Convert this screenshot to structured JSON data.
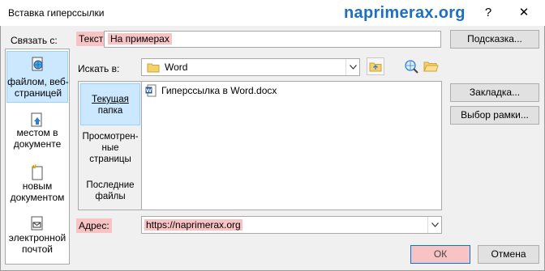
{
  "window": {
    "title": "Вставка гиперссылки",
    "watermark": "naprimerax.org",
    "help_label": "?",
    "close_label": "✕"
  },
  "link_to": {
    "label": "Связать с:",
    "items": [
      {
        "id": "file",
        "label_line1": "файлом, веб-",
        "label_line2": "страницей",
        "icon": "globe-document-icon",
        "selected": true
      },
      {
        "id": "place",
        "label_line1": "местом в",
        "label_line2": "документе",
        "icon": "document-bookmark-icon",
        "selected": false
      },
      {
        "id": "new",
        "label_line1": "новым",
        "label_line2": "документом",
        "icon": "new-document-icon",
        "selected": false
      },
      {
        "id": "email",
        "label_line1": "электронной",
        "label_line2": "почтой",
        "icon": "email-icon",
        "selected": false
      }
    ]
  },
  "text_field": {
    "label": "Текст:",
    "value": "На примерах"
  },
  "screentip_button": "Подсказка...",
  "look_in": {
    "label": "Искать в:",
    "value": "Word"
  },
  "nav": [
    {
      "id": "current",
      "label_line1": "Текущая",
      "label_line2": "папка",
      "selected": true
    },
    {
      "id": "browsed",
      "label_line1": "Просмотрен-",
      "label_line2": "ные",
      "label_line3": "страницы",
      "selected": false
    },
    {
      "id": "recent",
      "label_line1": "Последние",
      "label_line2": "файлы",
      "selected": false
    }
  ],
  "files": [
    {
      "name": "Гиперссылка в Word.docx",
      "icon": "word-document-icon"
    }
  ],
  "bookmark_button": "Закладка...",
  "target_frame_button": "Выбор рамки...",
  "address": {
    "label": "Адрес:",
    "value": "https://naprimerax.org"
  },
  "ok_button": "ОК",
  "cancel_button": "Отмена",
  "colors": {
    "highlight": "#f7c3c5",
    "selection": "#cce8ff",
    "watermark": "#1e6fc2"
  }
}
